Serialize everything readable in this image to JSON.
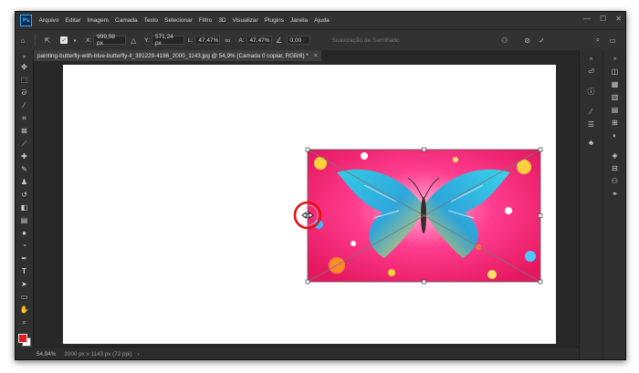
{
  "app": {
    "logo_text": "Ps"
  },
  "menu": [
    "Arquivo",
    "Editar",
    "Imagem",
    "Camada",
    "Texto",
    "Selecionar",
    "Filtro",
    "3D",
    "Visualizar",
    "Plugins",
    "Janela",
    "Ajuda"
  ],
  "window_controls": {
    "minimize": "—",
    "maximize": "☐",
    "close": "✕"
  },
  "options": {
    "x_label": "X:",
    "x_value": "999,98 px",
    "y_label": "Y:",
    "y_value": "571,24 px",
    "w_label": "L:",
    "w_value": "47,47%",
    "h_label": "A:",
    "h_value": "47,47%",
    "angle_value": "0,00",
    "interpolation_placeholder": "Suavização de Serrilhado"
  },
  "document_tab": {
    "title": "painting-butterfly-with-blue-butterfly-it_391229-4186_2000_1143.jpg @ 54,9% (Camada 0 copiar, RGB/8) *",
    "close": "×"
  },
  "status": {
    "zoom": "54,94%",
    "doc_size": "2000 px x 1143 px (72 ppi)",
    "arrow": "›"
  },
  "colors": {
    "foreground": "#e21b1b",
    "background": "#ffffff",
    "highlight_ring": "#e01414",
    "accent": "#31a8ff"
  },
  "icons": {
    "tools": [
      "move",
      "marquee",
      "lasso",
      "magic-wand",
      "crop",
      "frame",
      "eyedropper",
      "healing-brush",
      "brush",
      "clone-stamp",
      "history-brush",
      "eraser",
      "gradient",
      "blur",
      "dodge",
      "pen",
      "type",
      "path-selection",
      "rectangle",
      "hand",
      "zoom",
      "more"
    ],
    "dock": [
      "history",
      "info",
      "channels",
      "paths",
      "adjustments",
      "layers",
      "styles",
      "swatches",
      "color",
      "libraries",
      "properties"
    ]
  }
}
